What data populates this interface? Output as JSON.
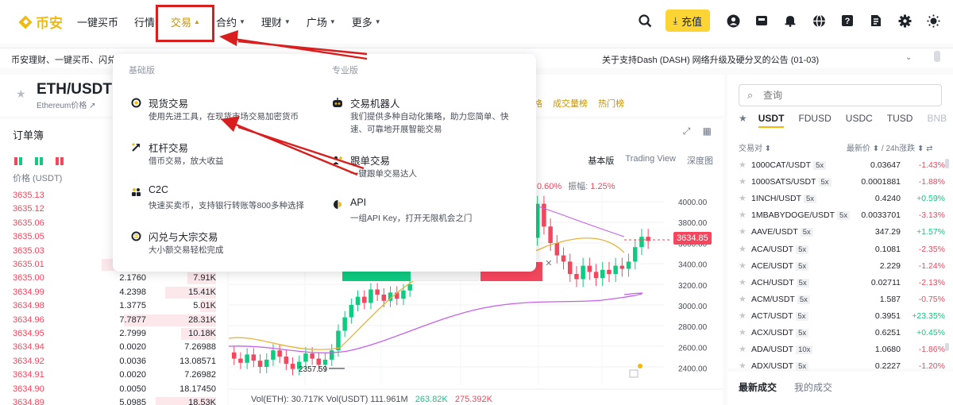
{
  "brand": {
    "name": "币安",
    "accent": "#f0b90b",
    "red": "#f6465d",
    "green": "#0ecb81"
  },
  "nav": {
    "items": [
      {
        "label": "一键买币",
        "chevron": false
      },
      {
        "label": "行情",
        "chevron": false
      },
      {
        "label": "交易",
        "chevron": true,
        "active": true
      },
      {
        "label": "合约",
        "chevron": true
      },
      {
        "label": "理财",
        "chevron": true
      },
      {
        "label": "广场",
        "chevron": true
      },
      {
        "label": "更多",
        "chevron": true
      }
    ],
    "deposit_label": "充值",
    "icons": [
      "search-icon",
      "download-icon",
      "user-icon",
      "wallet-icon",
      "bell-icon",
      "globe-icon",
      "help-icon",
      "exchange-icon",
      "gear-icon",
      "theme-icon"
    ]
  },
  "announcement": {
    "left": "币安理财、一键买币、闪兑",
    "right": "关于支持Dash (DASH) 网络升级及硬分叉的公告 (01-03)"
  },
  "symbol": {
    "pair": "ETH/USDT",
    "sub": "Ethereum价格 ↗",
    "rank_links": [
      "格",
      "成交量榜",
      "热门榜"
    ]
  },
  "orderbook": {
    "title": "订单簿",
    "head_price": "价格 (USDT)",
    "asks": [
      {
        "price": "3635.13",
        "amount": "",
        "total": "",
        "depth": 0
      },
      {
        "price": "3635.12",
        "amount": "",
        "total": "",
        "depth": 0
      },
      {
        "price": "3635.06",
        "amount": "",
        "total": "",
        "depth": 0
      },
      {
        "price": "3635.05",
        "amount": "",
        "total": "",
        "depth": 0
      },
      {
        "price": "3635.03",
        "amount": "",
        "total": "",
        "depth": 0
      },
      {
        "price": "3635.01",
        "amount": "",
        "total": "",
        "depth": 0.72
      },
      {
        "price": "3635.00",
        "amount": "2.1760",
        "total": "7.91K",
        "depth": 0.18
      },
      {
        "price": "3634.99",
        "amount": "4.2398",
        "total": "15.41K",
        "depth": 0.32
      },
      {
        "price": "3634.98",
        "amount": "1.3775",
        "total": "5.01K",
        "depth": 0.1
      },
      {
        "price": "3634.96",
        "amount": "7.7877",
        "total": "28.31K",
        "depth": 0.58
      },
      {
        "price": "3634.95",
        "amount": "2.7999",
        "total": "10.18K",
        "depth": 0.22
      },
      {
        "price": "3634.94",
        "amount": "0.0020",
        "total": "7.26988",
        "depth": 0
      },
      {
        "price": "3634.92",
        "amount": "0.0036",
        "total": "13.08571",
        "depth": 0
      },
      {
        "price": "3634.91",
        "amount": "0.0020",
        "total": "7.26982",
        "depth": 0
      },
      {
        "price": "3634.90",
        "amount": "0.0050",
        "total": "18.17450",
        "depth": 0
      },
      {
        "price": "3634.89",
        "amount": "5.0985",
        "total": "18.53K",
        "depth": 0.38
      }
    ]
  },
  "chart": {
    "tabs": [
      "基本版",
      "Trading View",
      "深度图"
    ],
    "change": "0.60%",
    "amp_label": "振幅:",
    "amp": "1.25%",
    "price_badge": "3634.85",
    "low_label": "2357.59",
    "y_ticks": [
      "4000.00",
      "3800.00",
      "3600.00",
      "3400.00",
      "3200.00",
      "3000.00",
      "2800.00",
      "2600.00",
      "2400.00"
    ],
    "vol_eth_label": "Vol(ETH):",
    "vol_eth": "30.717K",
    "vol_usdt_label": "Vol(USDT)",
    "vol_usdt": "111.961M",
    "vol_g": "263.82K",
    "vol_r": "275.392K",
    "candles": [
      {
        "o": 2540,
        "c": 2480
      },
      {
        "o": 2480,
        "c": 2440
      },
      {
        "o": 2440,
        "c": 2520
      },
      {
        "o": 2520,
        "c": 2460
      },
      {
        "o": 2460,
        "c": 2400
      },
      {
        "o": 2400,
        "c": 2470
      },
      {
        "o": 2470,
        "c": 2560
      },
      {
        "o": 2560,
        "c": 2500
      },
      {
        "o": 2500,
        "c": 2430
      },
      {
        "o": 2430,
        "c": 2380
      },
      {
        "o": 2380,
        "c": 2450
      },
      {
        "o": 2450,
        "c": 2530
      },
      {
        "o": 2530,
        "c": 2480
      },
      {
        "o": 2480,
        "c": 2420
      },
      {
        "o": 2420,
        "c": 2470
      },
      {
        "o": 2470,
        "c": 2560
      },
      {
        "o": 2560,
        "c": 2750
      },
      {
        "o": 2750,
        "c": 2880
      },
      {
        "o": 2880,
        "c": 3000
      },
      {
        "o": 3000,
        "c": 3080
      },
      {
        "o": 3080,
        "c": 3020
      },
      {
        "o": 3020,
        "c": 3150
      },
      {
        "o": 3150,
        "c": 3100
      },
      {
        "o": 3100,
        "c": 3040
      },
      {
        "o": 3040,
        "c": 3120
      },
      {
        "o": 3120,
        "c": 3060
      },
      {
        "o": 3060,
        "c": 3140
      },
      {
        "o": 3140,
        "c": 3200
      }
    ],
    "candles_right": [
      {
        "o": 3650,
        "c": 3980
      },
      {
        "o": 3980,
        "c": 3760
      },
      {
        "o": 3760,
        "c": 3600
      },
      {
        "o": 3600,
        "c": 3480
      },
      {
        "o": 3480,
        "c": 3420
      },
      {
        "o": 3420,
        "c": 3300
      },
      {
        "o": 3300,
        "c": 3250
      },
      {
        "o": 3250,
        "c": 3380
      },
      {
        "o": 3380,
        "c": 3320
      },
      {
        "o": 3320,
        "c": 3260
      },
      {
        "o": 3260,
        "c": 3340
      },
      {
        "o": 3340,
        "c": 3300
      },
      {
        "o": 3300,
        "c": 3380
      },
      {
        "o": 3380,
        "c": 3350
      },
      {
        "o": 3350,
        "c": 3420
      },
      {
        "o": 3420,
        "c": 3560
      },
      {
        "o": 3560,
        "c": 3660
      },
      {
        "o": 3660,
        "c": 3620
      }
    ]
  },
  "market": {
    "search_placeholder": "查询",
    "tabs": [
      "USDT",
      "FDUSD",
      "USDC",
      "TUSD",
      "BNB"
    ],
    "head_pair": "交易对 ⬍",
    "head_price": "最新价 ⬍ / 24h涨跌 ⬍ ⇄",
    "rows": [
      {
        "name": "1000CAT/USDT",
        "lev": "5x",
        "price": "0.03647",
        "change": "-1.43%"
      },
      {
        "name": "1000SATS/USDT",
        "lev": "5x",
        "price": "0.0001881",
        "change": "-1.88%"
      },
      {
        "name": "1INCH/USDT",
        "lev": "5x",
        "price": "0.4240",
        "change": "+0.59%"
      },
      {
        "name": "1MBABYDOGE/USDT",
        "lev": "5x",
        "price": "0.0033701",
        "change": "-3.13%"
      },
      {
        "name": "AAVE/USDT",
        "lev": "5x",
        "price": "347.29",
        "change": "+1.57%"
      },
      {
        "name": "ACA/USDT",
        "lev": "5x",
        "price": "0.1081",
        "change": "-2.35%"
      },
      {
        "name": "ACE/USDT",
        "lev": "5x",
        "price": "2.229",
        "change": "-1.24%"
      },
      {
        "name": "ACH/USDT",
        "lev": "5x",
        "price": "0.02711",
        "change": "-2.13%"
      },
      {
        "name": "ACM/USDT",
        "lev": "5x",
        "price": "1.587",
        "change": "-0.75%"
      },
      {
        "name": "ACT/USDT",
        "lev": "5x",
        "price": "0.3951",
        "change": "+23.35%"
      },
      {
        "name": "ACX/USDT",
        "lev": "5x",
        "price": "0.6251",
        "change": "+0.45%"
      },
      {
        "name": "ADA/USDT",
        "lev": "10x",
        "price": "1.0680",
        "change": "-1.86%"
      },
      {
        "name": "ADX/USDT",
        "lev": "5x",
        "price": "0.2227",
        "change": "-1.20%"
      }
    ]
  },
  "trades": {
    "tab1": "最新成交",
    "tab2": "我的成交"
  },
  "dropdown": {
    "basic_title": "基础版",
    "pro_title": "专业版",
    "basic": [
      {
        "icon": "spot-icon",
        "title": "现货交易",
        "desc": "使用先进工具，在现货市场交易加密货币"
      },
      {
        "icon": "margin-icon",
        "title": "杠杆交易",
        "desc": "借币交易，放大收益"
      },
      {
        "icon": "c2c-icon",
        "title": "C2C",
        "desc": "快速买卖币，支持银行转账等800多种选择"
      },
      {
        "icon": "convert-icon",
        "title": "闪兑与大宗交易",
        "desc": "大小额交易轻松完成"
      }
    ],
    "pro": [
      {
        "icon": "bot-icon",
        "title": "交易机器人",
        "desc": "我们提供多种自动化策略，助力您简单、快速、可靠地开展智能交易"
      },
      {
        "icon": "copy-trading-icon",
        "title": "跟单交易",
        "desc": "一键跟单交易达人"
      },
      {
        "icon": "api-icon",
        "title": "API",
        "desc": "一组API Key，打开无限机会之门"
      }
    ]
  }
}
